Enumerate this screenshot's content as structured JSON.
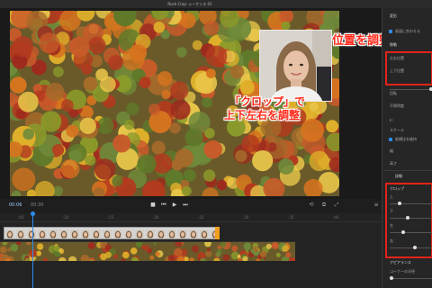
{
  "window": {
    "title": "Rush Crop: シーケンス 01"
  },
  "annotations": {
    "position": "位置を調整",
    "crop_line1": "「クロップ」で",
    "crop_line2": "上下左右を調整"
  },
  "transport": {
    "timecode": "00:06",
    "duration": "00:30"
  },
  "timeline": {
    "ruler_ticks": [
      ":05",
      ":10",
      ":15",
      ":20",
      ":25",
      ":30",
      ":35",
      ":40"
    ]
  },
  "inspector": {
    "section_label": "変形",
    "checkbox_fit": "画面に合わせる",
    "section_move": "移動",
    "field_pos_x": "左右位置",
    "field_pos_y": "上下位置",
    "field_rotate": "回転",
    "field_opacity": "不透明度",
    "field_scale": "スケール",
    "checkbox_ratio": "縦横比を維持",
    "field_w": "幅",
    "field_h": "高さ",
    "section_detail": "詳細",
    "section_crop": "クロップ",
    "crop_top": "上",
    "crop_bottom": "下",
    "crop_left": "左",
    "crop_right": "右",
    "section_appearance": "アピアランス",
    "field_corner": "コーナーの半径",
    "crop_levels": [
      0.2,
      0.4,
      0.3,
      0.6
    ]
  },
  "colors": {
    "annotation_red": "#ff2a1a",
    "accent_blue": "#2d8ceb",
    "clip_orange": "#f0a020"
  }
}
